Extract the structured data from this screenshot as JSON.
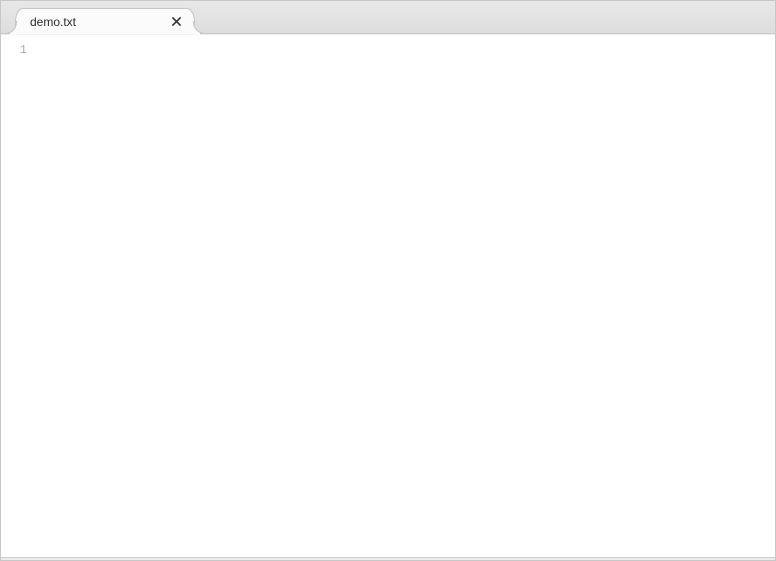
{
  "tabs": [
    {
      "label": "demo.txt",
      "active": true
    }
  ],
  "editor": {
    "line_numbers": [
      "1"
    ],
    "content": ""
  }
}
